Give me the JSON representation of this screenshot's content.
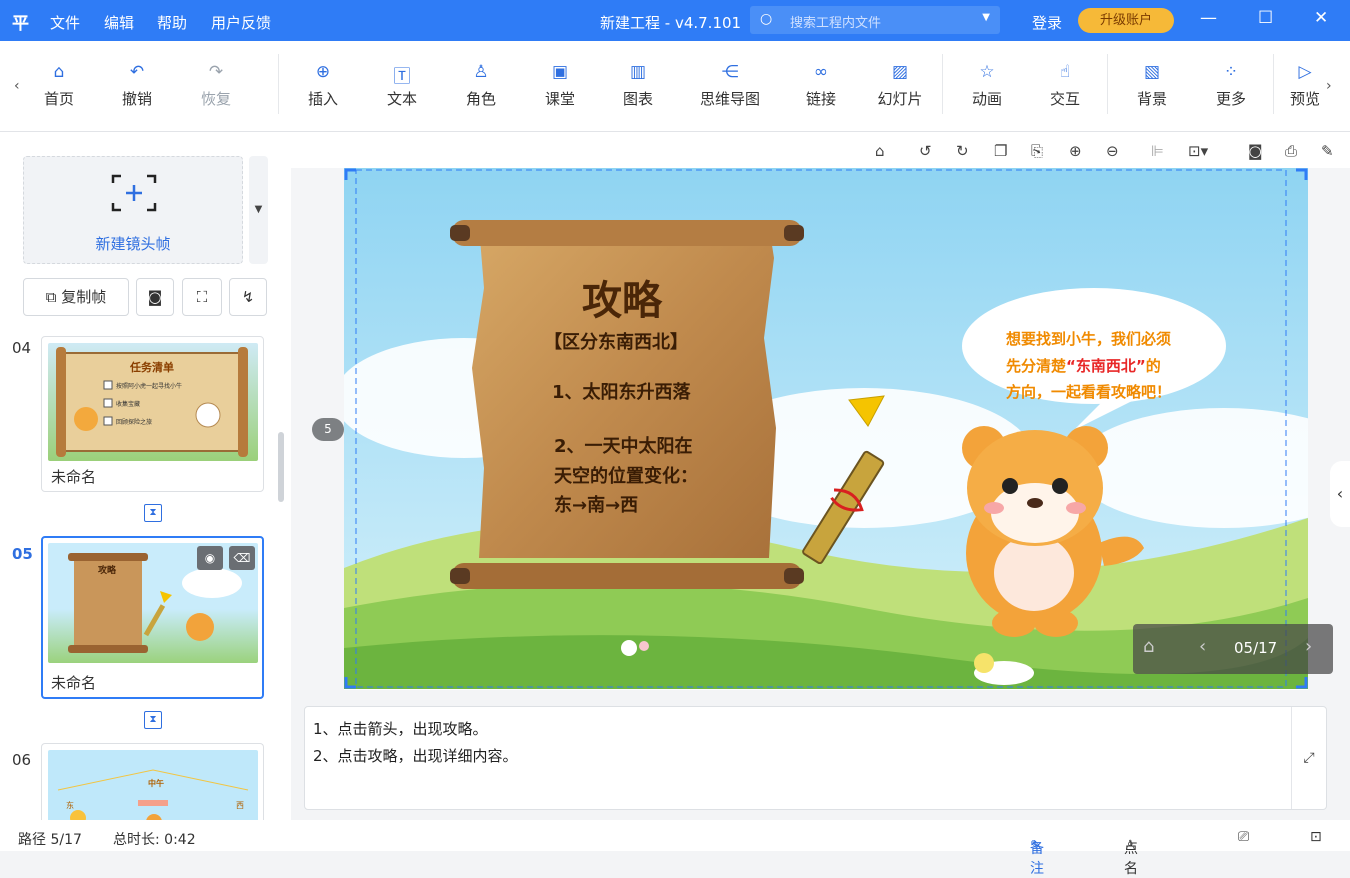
{
  "app": {
    "logo": "平",
    "menus": [
      "文件",
      "编辑",
      "帮助",
      "用户反馈"
    ],
    "title": "新建工程 - v4.7.101",
    "search_placeholder": "搜索工程内文件",
    "login": "登录",
    "upgrade": "升级账户"
  },
  "toolbar": {
    "items": [
      "首页",
      "撤销",
      "恢复",
      "插入",
      "文本",
      "角色",
      "课堂",
      "图表",
      "思维导图",
      "链接",
      "幻灯片",
      "动画",
      "交互",
      "背景",
      "更多",
      "预览"
    ]
  },
  "left_panel": {
    "new_frame": "新建镜头帧",
    "copy_frame": "复制帧",
    "frames": [
      {
        "num": "04",
        "name": "未命名",
        "thumb_title": "任务清单",
        "thumb_items": [
          "按照阿小虎一起寻找小牛",
          "收集宝藏",
          "回顾探险之旅"
        ]
      },
      {
        "num": "05",
        "name": "未命名",
        "thumb_title": "攻略"
      },
      {
        "num": "06",
        "name": "",
        "thumb_title": "中午",
        "thumb_labels": [
          "东",
          "西"
        ]
      }
    ]
  },
  "slide": {
    "scroll_title": "攻略",
    "scroll_subtitle": "【区分东南西北】",
    "point1": "1、太阳东升西落",
    "point2_line1": "2、一天中太阳在",
    "point2_line2": "天空的位置变化：",
    "point2_line3": "东→南→西",
    "bubble_line1": "想要找到小牛，我们必须",
    "bubble_line2_a": "先分清楚",
    "bubble_line2_highlight": "“东南西北”",
    "bubble_line2_b": "的",
    "bubble_line3": "方向，一起看看攻略吧！",
    "path_badge": "5",
    "page_indicator": "05/17"
  },
  "notes": {
    "line1": "1、点击箭头，出现攻略。",
    "line2": "2、点击攻略，出现详细内容。"
  },
  "status": {
    "path": "路径 5/17",
    "duration": "总时长: 0:42",
    "notes_btn": "备注",
    "rollcall_btn": "点名"
  },
  "colors": {
    "accent": "#2f7cf6",
    "upgrade": "#f6b938",
    "bubble_text": "#f08a00",
    "bubble_highlight": "#e82727"
  }
}
